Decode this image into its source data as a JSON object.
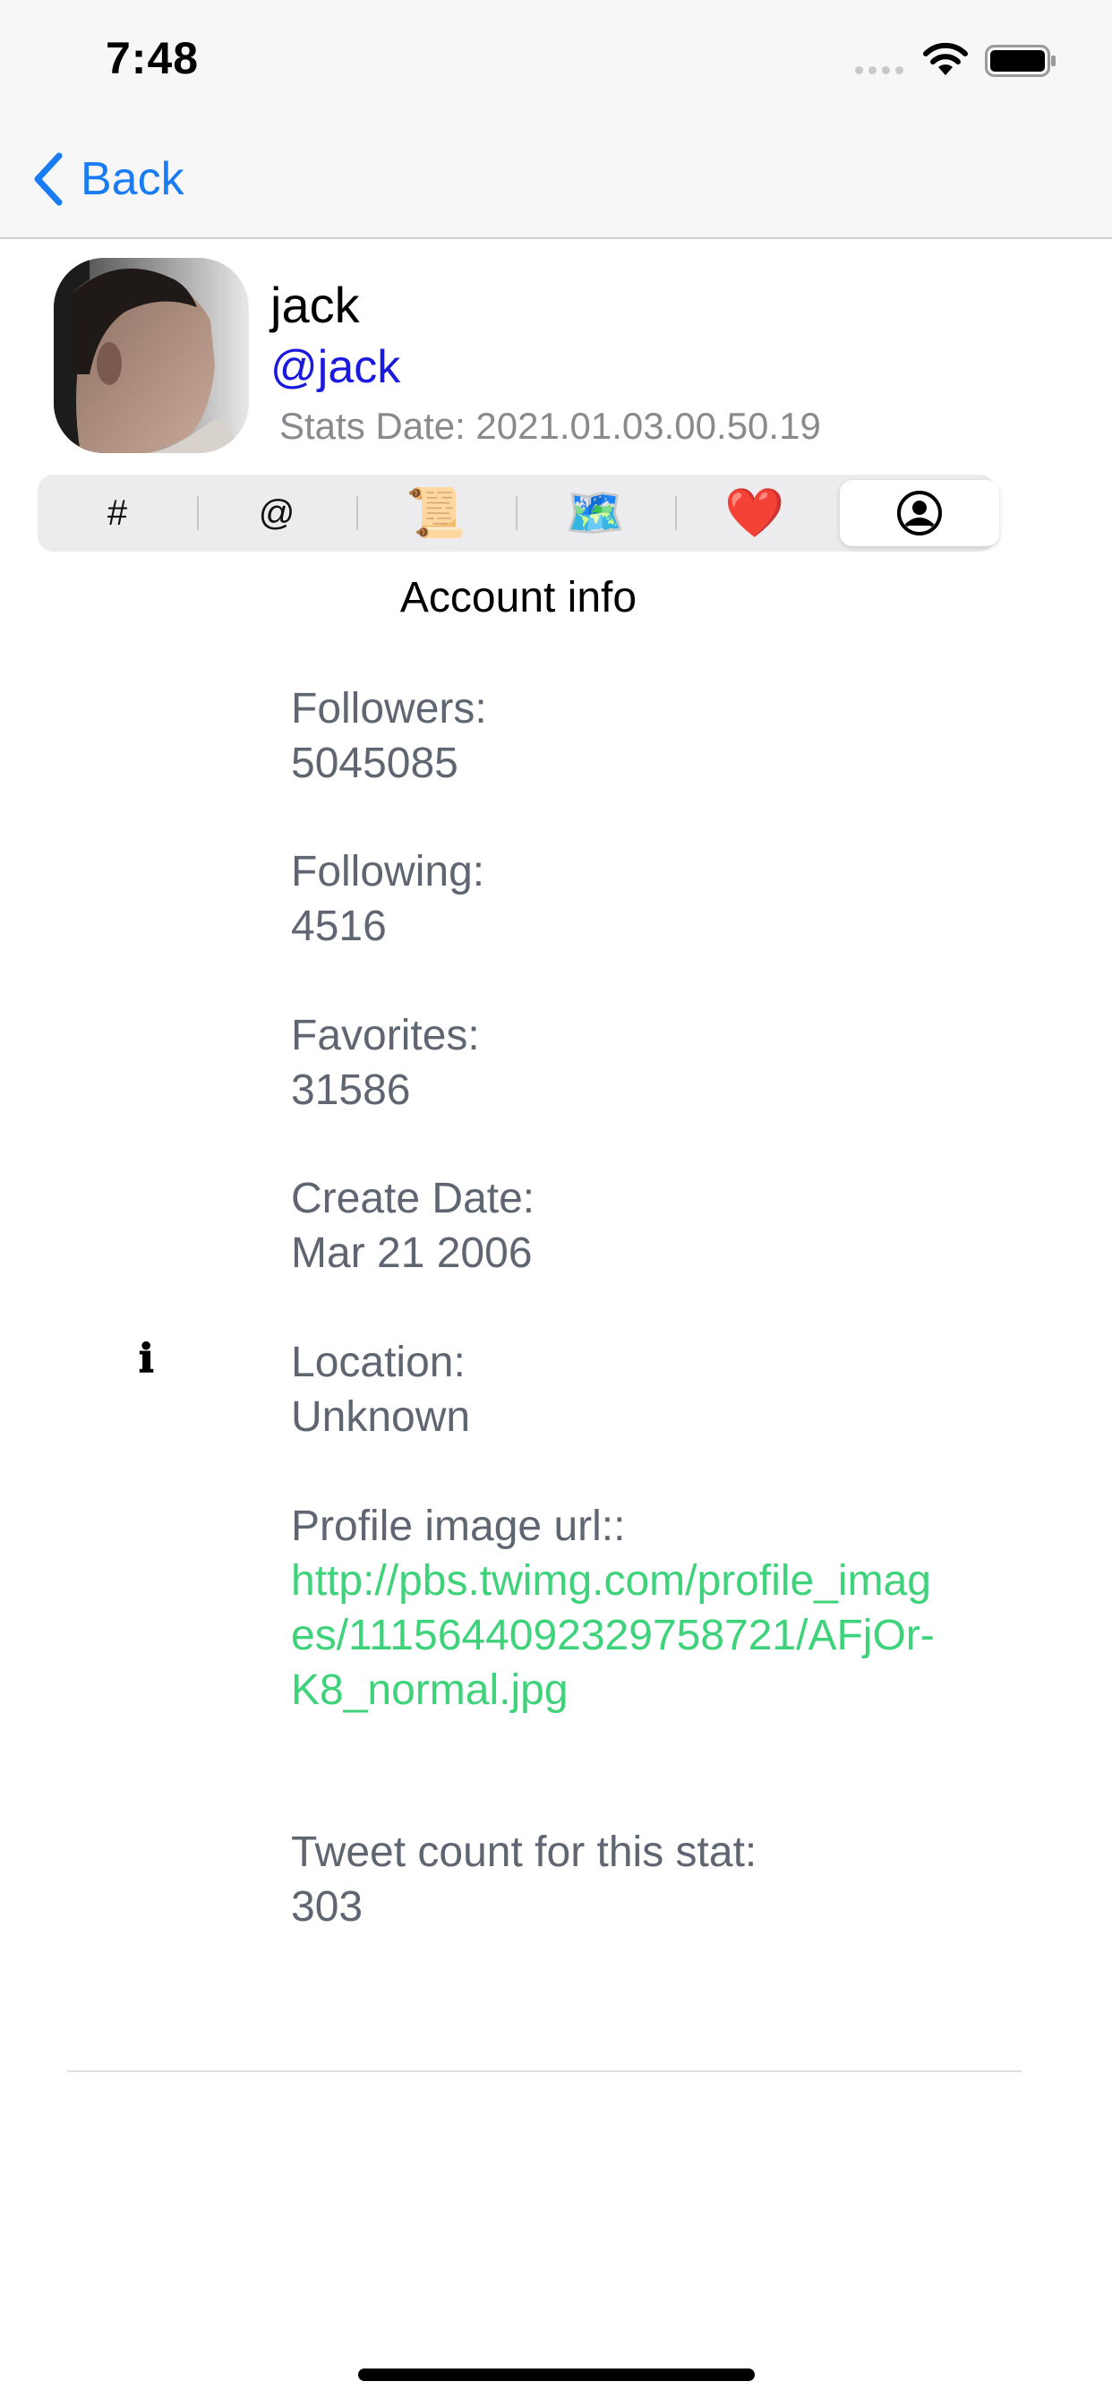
{
  "status_bar": {
    "time": "7:48"
  },
  "nav": {
    "back_label": "Back",
    "accent_color": "#1a7cf2"
  },
  "profile": {
    "name": "jack",
    "handle": "@jack",
    "stats_date": "Stats Date: 2021.01.03.00.50.19"
  },
  "tabs": [
    {
      "label": "#",
      "icon": "hashtag-icon"
    },
    {
      "label": "@",
      "icon": "mention-icon"
    },
    {
      "label": "📜",
      "icon": "scroll-icon"
    },
    {
      "label": "🗺️",
      "icon": "map-icon"
    },
    {
      "label": "❤️",
      "icon": "heart-icon"
    },
    {
      "label": "",
      "icon": "person-circle-icon",
      "selected": true
    }
  ],
  "account_info": {
    "title": "Account info",
    "info_icon": "ℹ",
    "followers_label": "Followers:",
    "followers_value": "5045085",
    "following_label": "Following:",
    "following_value": "4516",
    "favorites_label": "Favorites:",
    "favorites_value": "31586",
    "create_date_label": "Create Date:",
    "create_date_value": "Mar 21 2006",
    "location_label": "Location:",
    "location_value": "Unknown",
    "profile_image_label": "Profile image url::",
    "profile_image_url": "http://pbs.twimg.com/profile_images/1115644092329758721/AFjOr-K8_normal.jpg",
    "tweet_count_label": "Tweet count for this stat:",
    "tweet_count_value": "303",
    "link_color": "#3ed27a"
  }
}
